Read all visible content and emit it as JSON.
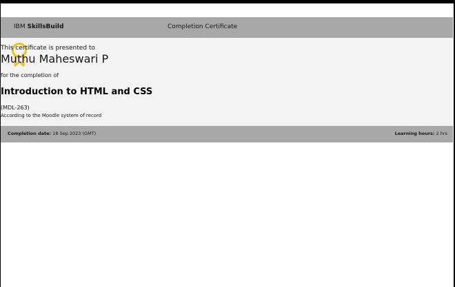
{
  "header": {
    "brand_prefix": "IBM",
    "brand_name": "SkillsBuild",
    "title": "Completion Certificate"
  },
  "certificate": {
    "presented_text": "This certificate is presented to",
    "recipient": "Muthu Maheswari P",
    "completion_text": "for the completion of",
    "course_title": "Introduction to HTML and CSS",
    "course_code": "(MDL-263)",
    "record_note": "According to the Moodle system of record",
    "badge_icon": "award-ribbon-icon"
  },
  "footer": {
    "date_label": "Completion date:",
    "date_value": "18 Sep 2023 (GMT)",
    "hours_label": "Learning hours:",
    "hours_value": "2 hrs"
  },
  "colors": {
    "header_bg": "#a8a8a8",
    "body_bg": "#f3f3f3",
    "badge": "#f1c21b"
  }
}
